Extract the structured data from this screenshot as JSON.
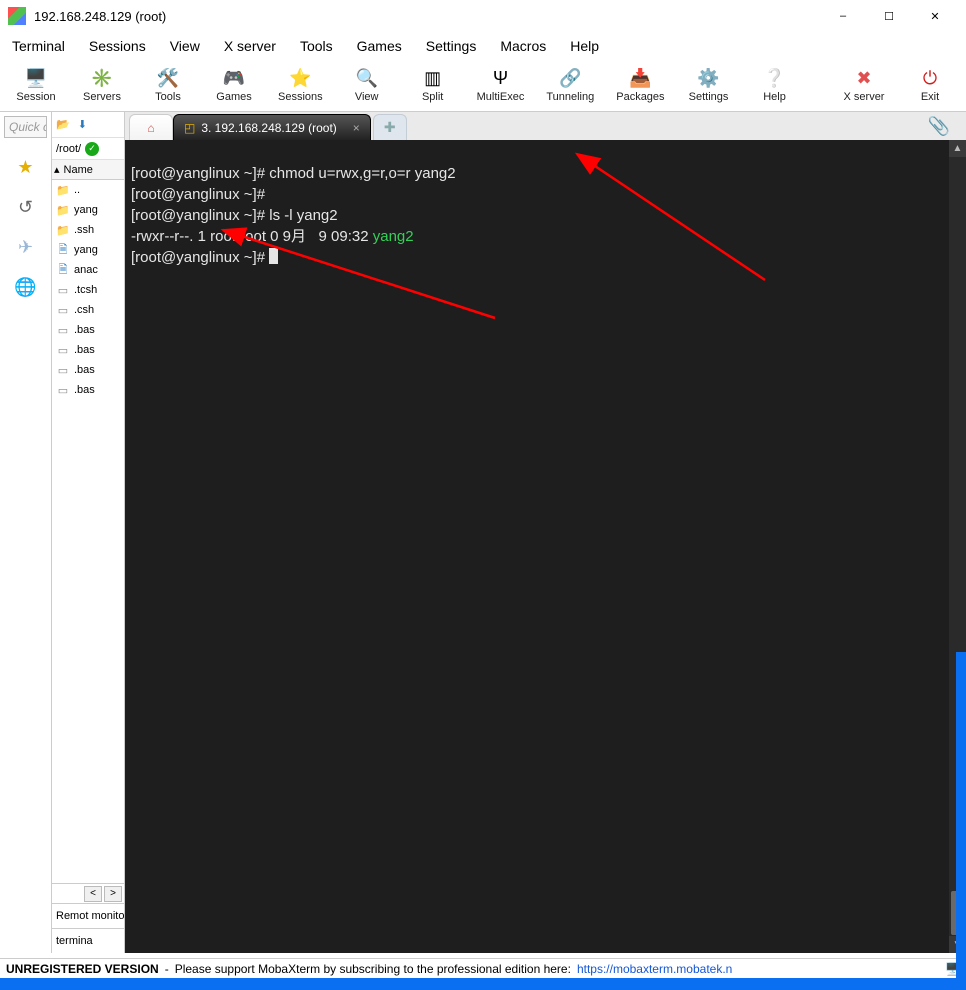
{
  "window": {
    "title": "192.168.248.129 (root)"
  },
  "menubar": [
    "Terminal",
    "Sessions",
    "View",
    "X server",
    "Tools",
    "Games",
    "Settings",
    "Macros",
    "Help"
  ],
  "toolbar": [
    {
      "label": "Session",
      "icon": "🖥️"
    },
    {
      "label": "Servers",
      "icon": "✳️"
    },
    {
      "label": "Tools",
      "icon": "🛠️"
    },
    {
      "label": "Games",
      "icon": "🎮"
    },
    {
      "label": "Sessions",
      "icon": "⭐"
    },
    {
      "label": "View",
      "icon": "🔍"
    },
    {
      "label": "Split",
      "icon": "▥"
    },
    {
      "label": "MultiExec",
      "icon": "Ψ"
    },
    {
      "label": "Tunneling",
      "icon": "🔗"
    },
    {
      "label": "Packages",
      "icon": "📥"
    },
    {
      "label": "Settings",
      "icon": "⚙️"
    },
    {
      "label": "Help",
      "icon": "❔"
    },
    {
      "label": "X server",
      "icon": "✖"
    },
    {
      "label": "Exit",
      "icon": "⏻"
    }
  ],
  "quick": {
    "placeholder": "Quick conne"
  },
  "filepanel": {
    "path": "/root/",
    "header_col": "Name",
    "items": [
      {
        "name": "..",
        "type": "folder-special"
      },
      {
        "name": "yang",
        "type": "folder"
      },
      {
        "name": ".ssh",
        "type": "folder"
      },
      {
        "name": "yang",
        "type": "file"
      },
      {
        "name": "anac",
        "type": "file"
      },
      {
        "name": ".tcsh",
        "type": "gray"
      },
      {
        "name": ".csh",
        "type": "gray"
      },
      {
        "name": ".bas",
        "type": "gray"
      },
      {
        "name": ".bas",
        "type": "gray"
      },
      {
        "name": ".bas",
        "type": "gray"
      },
      {
        "name": ".bas",
        "type": "gray"
      }
    ],
    "remote_label": "Remot monitor",
    "terminal_label": "termina"
  },
  "tabs": {
    "session_label": "3. 192.168.248.129 (root)"
  },
  "terminal": {
    "lines": [
      {
        "prompt": "[root@yanglinux ~]# ",
        "cmd": "chmod u=rwx,g=r,o=r yang2"
      },
      {
        "prompt": "[root@yanglinux ~]# ",
        "cmd": ""
      },
      {
        "prompt": "[root@yanglinux ~]# ",
        "cmd": "ls -l yang2"
      },
      {
        "ls": "-rwxr--r--. 1 root root 0 9月   9 09:32 ",
        "file": "yang2"
      },
      {
        "prompt": "[root@yanglinux ~]# ",
        "cursor": true
      }
    ]
  },
  "status": {
    "unreg": "UNREGISTERED VERSION",
    "sep": "  -  ",
    "msg": "Please support MobaXterm by subscribing to the professional edition here:  ",
    "link": "https://mobaxterm.mobatek.n"
  }
}
